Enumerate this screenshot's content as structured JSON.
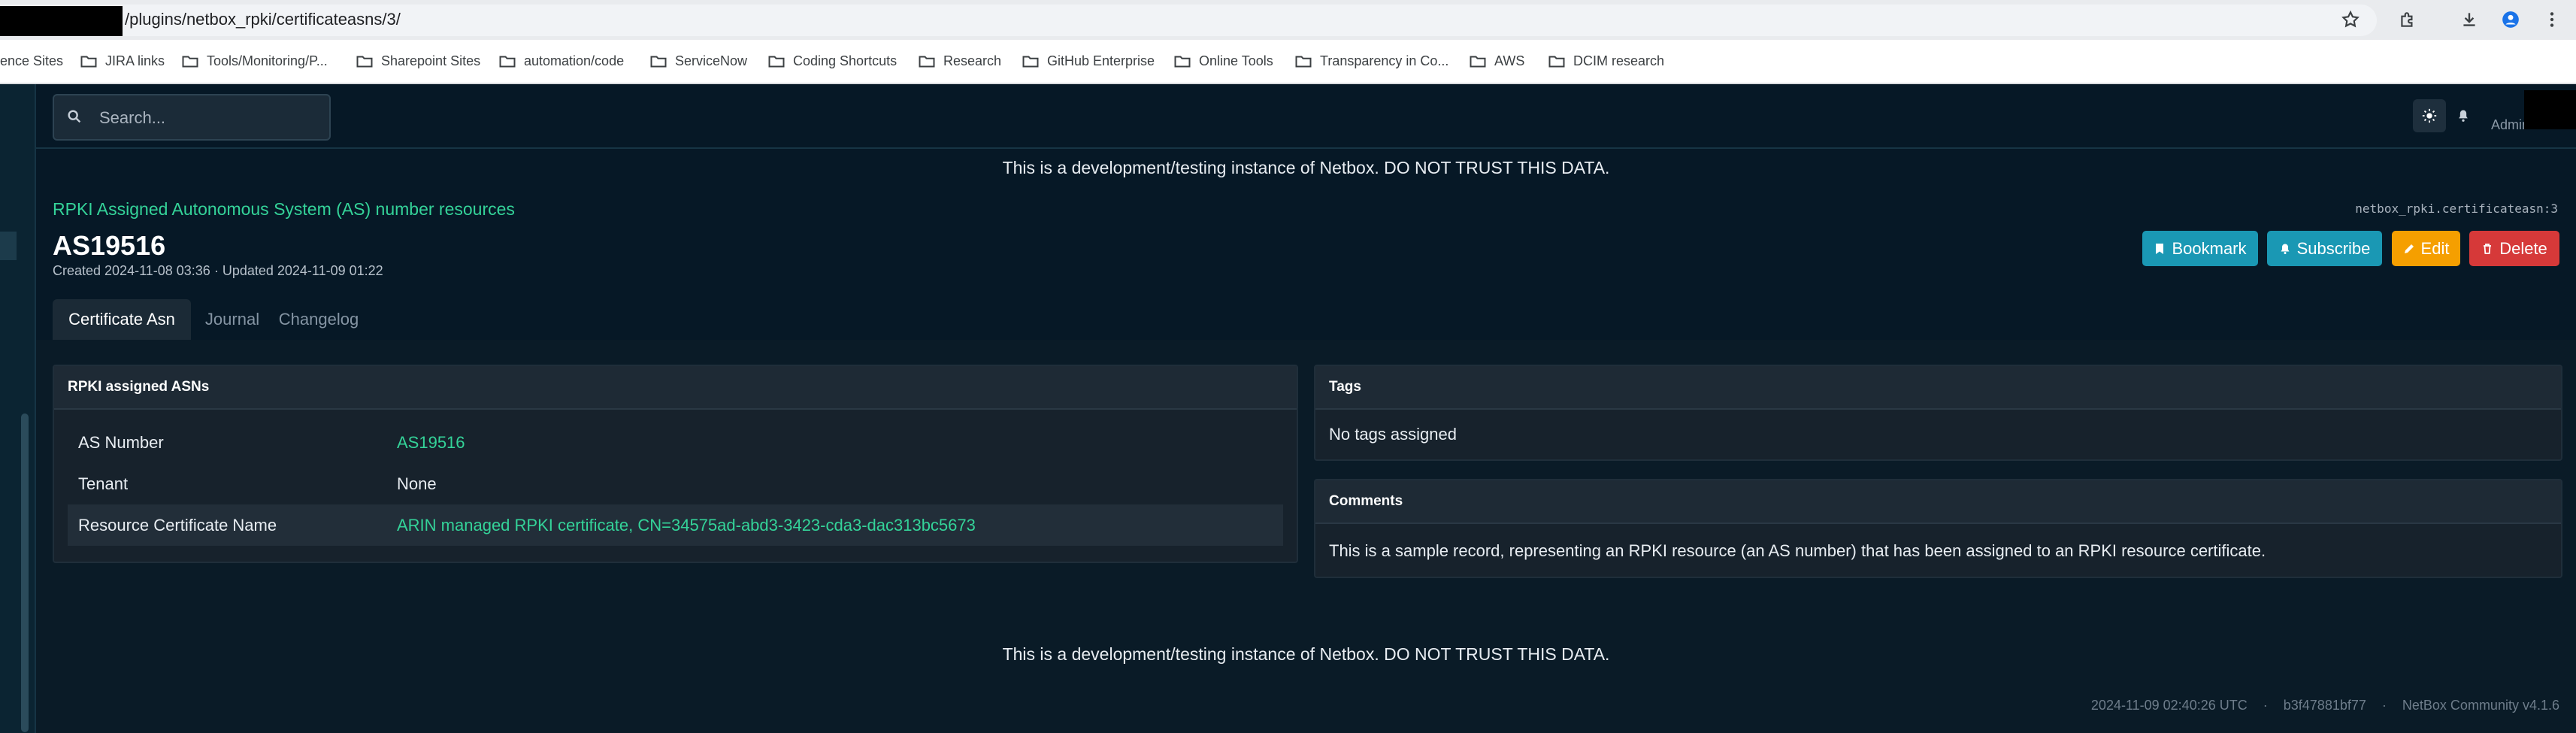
{
  "browser": {
    "url": "/plugins/netbox_rpki/certificateasns/3/",
    "bookmarks": [
      {
        "label": "ence Sites"
      },
      {
        "label": "JIRA links"
      },
      {
        "label": "Tools/Monitoring/P..."
      },
      {
        "label": "Sharepoint Sites"
      },
      {
        "label": "automation/code"
      },
      {
        "label": "ServiceNow"
      },
      {
        "label": "Coding Shortcuts"
      },
      {
        "label": "Research"
      },
      {
        "label": "GitHub Enterprise"
      },
      {
        "label": "Online Tools"
      },
      {
        "label": "Transparency in Co..."
      },
      {
        "label": "AWS"
      },
      {
        "label": "DCIM research"
      }
    ]
  },
  "header": {
    "search_placeholder": "Search...",
    "user_label": "Admin"
  },
  "banner": {
    "top": "This is a development/testing instance of Netbox. DO NOT TRUST THIS DATA.",
    "bottom": "This is a development/testing instance of Netbox. DO NOT TRUST THIS DATA."
  },
  "page": {
    "breadcrumb": "RPKI Assigned Autonomous System (AS) number resources",
    "model_label": "netbox_rpki.certificateasn:3",
    "title": "AS19516",
    "subtitle": "Created 2024-11-08 03:36 · Updated 2024-11-09 01:22"
  },
  "actions": {
    "bookmark": "Bookmark",
    "subscribe": "Subscribe",
    "edit": "Edit",
    "delete": "Delete",
    "colors": {
      "bookmark": "#1a98b4",
      "subscribe": "#1a98b4",
      "edit": "#f59f00",
      "delete": "#d63939"
    }
  },
  "tabs": [
    {
      "label": "Certificate Asn",
      "active": true
    },
    {
      "label": "Journal",
      "active": false
    },
    {
      "label": "Changelog",
      "active": false
    }
  ],
  "rpki_card": {
    "header": "RPKI assigned ASNs",
    "rows": [
      {
        "key": "AS Number",
        "value": "AS19516",
        "link": true
      },
      {
        "key": "Tenant",
        "value": "None",
        "link": false
      },
      {
        "key": "Resource Certificate Name",
        "value": "ARIN managed RPKI certificate, CN=34575ad-abd3-3423-cda3-dac313bc5673",
        "link": true
      }
    ]
  },
  "tags_card": {
    "header": "Tags",
    "empty_text": "No tags assigned"
  },
  "comments_card": {
    "header": "Comments",
    "text": "This is a sample record, representing an RPKI resource (an AS number) that has been assigned to an RPKI resource certificate."
  },
  "footer": {
    "timestamp": "2024-11-09 02:40:26 UTC",
    "commit": "b3f47881bf77",
    "version": "NetBox Community v4.1.6"
  },
  "colors": {
    "accent_link": "#34d399",
    "background": "#061826"
  }
}
